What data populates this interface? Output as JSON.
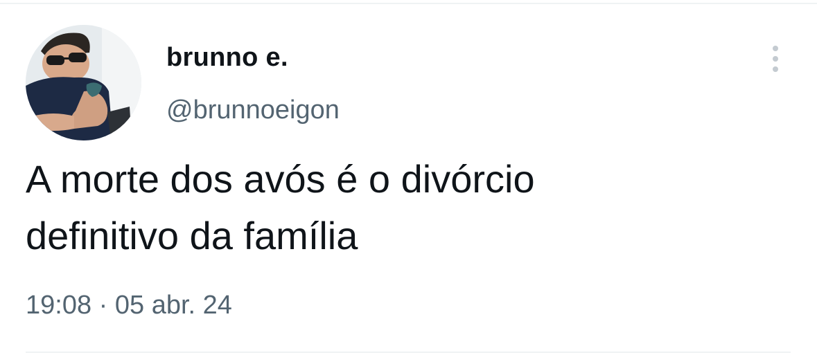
{
  "tweet": {
    "author": {
      "display_name": "brunno e.",
      "handle": "@brunnoeigon",
      "avatar": "profile-photo"
    },
    "text": "A morte dos avós é o divórcio\ndefinitivo da família",
    "timestamp": "19:08 · 05 abr. 24",
    "more_icon": "vertical-ellipsis-icon"
  },
  "colors": {
    "text_primary": "#0f1419",
    "text_secondary": "#536471",
    "divider": "#eff3f4",
    "icon_muted": "#c4cbd1"
  }
}
